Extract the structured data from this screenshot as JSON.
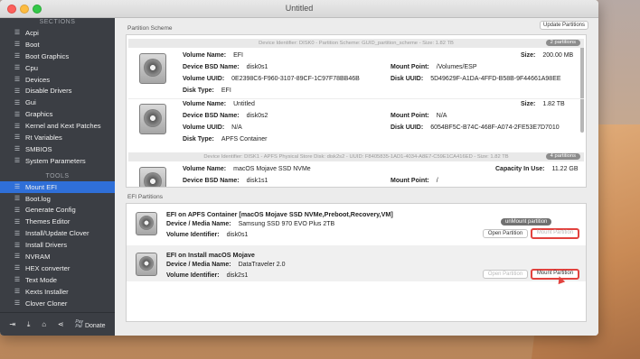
{
  "window": {
    "title": "Untitled"
  },
  "sidebar": {
    "sections_header": "SECTIONS",
    "sections": [
      {
        "label": "Acpi"
      },
      {
        "label": "Boot"
      },
      {
        "label": "Boot Graphics"
      },
      {
        "label": "Cpu"
      },
      {
        "label": "Devices"
      },
      {
        "label": "Disable Drivers"
      },
      {
        "label": "Gui"
      },
      {
        "label": "Graphics"
      },
      {
        "label": "Kernel and Kext Patches"
      },
      {
        "label": "Rt Variables"
      },
      {
        "label": "SMBIOS"
      },
      {
        "label": "System Parameters"
      }
    ],
    "tools_header": "TOOLS",
    "tools": [
      {
        "label": "Mount EFI"
      },
      {
        "label": "Boot.log"
      },
      {
        "label": "Generate Config"
      },
      {
        "label": "Themes Editor"
      },
      {
        "label": "Install/Update Clover"
      },
      {
        "label": "Install Drivers"
      },
      {
        "label": "NVRAM"
      },
      {
        "label": "HEX converter"
      },
      {
        "label": "Text Mode"
      },
      {
        "label": "Kexts Installer"
      },
      {
        "label": "Clover Cloner"
      }
    ],
    "active_tool": "Mount EFI",
    "bottom": {
      "donate_label": "Donate",
      "paypal_top": "Pay",
      "paypal_bottom": "Pal"
    }
  },
  "partition_scheme": {
    "label": "Partition Scheme",
    "update_button": "Update Partitions",
    "disk0": {
      "banner": "Device Identifier: DISK0 - Partition Scheme: GUID_partition_scheme - Size: 1.82 TB",
      "badge": "2 partitions",
      "partitions": [
        {
          "volume_name_label": "Volume Name:",
          "volume_name": "EFI",
          "size_label": "Size:",
          "size": "200.00 MB",
          "bsd_label": "Device BSD Name:",
          "bsd": "disk0s1",
          "mount_label": "Mount Point:",
          "mount": "/Volumes/ESP",
          "vuuid_label": "Volume UUID:",
          "vuuid": "0E2398C6-F960-3107-89CF-1C97F78BB46B",
          "duuid_label": "Disk UUID:",
          "duuid": "5D49629F-A1DA-4FFD-B58B-9F44661A98EE",
          "type_label": "Disk Type:",
          "type": "EFI"
        },
        {
          "volume_name_label": "Volume Name:",
          "volume_name": "Untitled",
          "size_label": "Size:",
          "size": "1.82 TB",
          "bsd_label": "Device BSD Name:",
          "bsd": "disk0s2",
          "mount_label": "Mount Point:",
          "mount": "N/A",
          "vuuid_label": "Volume UUID:",
          "vuuid": "N/A",
          "duuid_label": "Disk UUID:",
          "duuid": "6054BF5C-B74C-468F-A074-2FE53E7D7010",
          "type_label": "Disk Type:",
          "type": "APFS Container"
        }
      ]
    },
    "disk1": {
      "banner": "Device Identifier: DISK1 - APFS Physical Store Disk: disk2s2 - UUID: F8405835-1AD1-4034-A8E7-C59E1CA416ED - Size: 1.82 TB",
      "badge": "4 partitions",
      "partition": {
        "volume_name_label": "Volume Name:",
        "volume_name": "macOS Mojave SSD NVMe",
        "capacity_label": "Capacity In Use:",
        "capacity": "11.22 GB",
        "bsd_label": "Device BSD Name:",
        "bsd": "disk1s1",
        "mount_label": "Mount Point:",
        "mount": "/"
      }
    }
  },
  "efi_partitions": {
    "label": "EFI Partitions",
    "items": [
      {
        "title": "EFI on APFS Container [macOS Mojave SSD NVMe,Preboot,Recovery,VM]",
        "media_label": "Device / Media Name:",
        "media": "Samsung SSD 970 EVO Plus 2TB",
        "vid_label": "Volume Identifier:",
        "vid": "disk0s1",
        "status_badge": "unMount partition",
        "open_label": "Open Partition",
        "mount_label": "Mount Partition"
      },
      {
        "title": "EFI on Install macOS Mojave",
        "media_label": "Device / Media Name:",
        "media": "DataTraveler 2.0",
        "vid_label": "Volume Identifier:",
        "vid": "disk2s1",
        "open_label": "Open Partition",
        "mount_label": "Mount Partition"
      }
    ]
  },
  "colors": {
    "sidebar_bg": "#3b3e44",
    "active_item": "#2f6fd8",
    "highlight": "#e2423e"
  }
}
